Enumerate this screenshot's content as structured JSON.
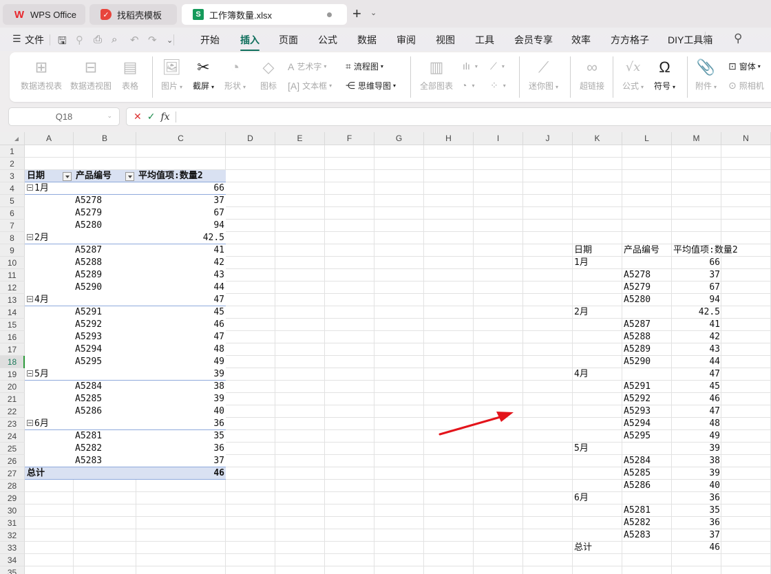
{
  "tabs": [
    {
      "label": "WPS Office",
      "icon": "wps-logo-icon",
      "color": "#e8262c"
    },
    {
      "label": "找稻壳模板",
      "icon": "docer-icon",
      "color": "#e8453c"
    },
    {
      "label": "工作簿数量.xlsx",
      "icon": "spreadsheet-s-icon",
      "color": "#159a5b",
      "active": true
    }
  ],
  "newtab_label": "+",
  "menu": {
    "file_label": "文件",
    "items": [
      "开始",
      "插入",
      "页面",
      "公式",
      "数据",
      "审阅",
      "视图",
      "工具",
      "会员专享",
      "效率",
      "方方格子",
      "DIY工具箱"
    ],
    "active": "插入"
  },
  "ribbon": {
    "pivot_table": "数据透视表",
    "pivot_chart": "数据透视图",
    "table": "表格",
    "picture": "图片",
    "screenshot": "截屏",
    "shape": "形状",
    "icon": "图标",
    "wordart": "艺术字",
    "textbox": "文本框",
    "flowchart": "流程图",
    "mindmap": "思维导图",
    "all_charts": "全部图表",
    "sparkline": "迷你图",
    "hyperlink": "超链接",
    "formula": "公式",
    "symbol": "符号",
    "attachment": "附件",
    "form": "窗体",
    "camera": "照相机"
  },
  "formula_bar": {
    "name_box": "Q18",
    "fx": "fx",
    "value": ""
  },
  "columns": [
    "A",
    "B",
    "C",
    "D",
    "E",
    "F",
    "G",
    "H",
    "I",
    "J",
    "K",
    "L",
    "M",
    "N"
  ],
  "row_count": 35,
  "selected_row": 18,
  "pivot": {
    "headers": [
      "日期",
      "产品编号",
      "平均值项:数量2"
    ],
    "rows": [
      {
        "row": 4,
        "date": "1月",
        "product": "",
        "value": "66",
        "group": true
      },
      {
        "row": 5,
        "date": "",
        "product": "A5278",
        "value": "37"
      },
      {
        "row": 6,
        "date": "",
        "product": "A5279",
        "value": "67"
      },
      {
        "row": 7,
        "date": "",
        "product": "A5280",
        "value": "94"
      },
      {
        "row": 8,
        "date": "2月",
        "product": "",
        "value": "42.5",
        "group": true
      },
      {
        "row": 9,
        "date": "",
        "product": "A5287",
        "value": "41"
      },
      {
        "row": 10,
        "date": "",
        "product": "A5288",
        "value": "42"
      },
      {
        "row": 11,
        "date": "",
        "product": "A5289",
        "value": "43"
      },
      {
        "row": 12,
        "date": "",
        "product": "A5290",
        "value": "44"
      },
      {
        "row": 13,
        "date": "4月",
        "product": "",
        "value": "47",
        "group": true
      },
      {
        "row": 14,
        "date": "",
        "product": "A5291",
        "value": "45"
      },
      {
        "row": 15,
        "date": "",
        "product": "A5292",
        "value": "46"
      },
      {
        "row": 16,
        "date": "",
        "product": "A5293",
        "value": "47"
      },
      {
        "row": 17,
        "date": "",
        "product": "A5294",
        "value": "48"
      },
      {
        "row": 18,
        "date": "",
        "product": "A5295",
        "value": "49"
      },
      {
        "row": 19,
        "date": "5月",
        "product": "",
        "value": "39",
        "group": true
      },
      {
        "row": 20,
        "date": "",
        "product": "A5284",
        "value": "38"
      },
      {
        "row": 21,
        "date": "",
        "product": "A5285",
        "value": "39"
      },
      {
        "row": 22,
        "date": "",
        "product": "A5286",
        "value": "40"
      },
      {
        "row": 23,
        "date": "6月",
        "product": "",
        "value": "36",
        "group": true
      },
      {
        "row": 24,
        "date": "",
        "product": "A5281",
        "value": "35"
      },
      {
        "row": 25,
        "date": "",
        "product": "A5282",
        "value": "36"
      },
      {
        "row": 26,
        "date": "",
        "product": "A5283",
        "value": "37"
      }
    ],
    "total_label": "总计",
    "total_value": "46"
  },
  "copy_table": {
    "header_row": 9,
    "headers": [
      "日期",
      "产品编号",
      "平均值项:数量2"
    ],
    "rows": [
      {
        "date": "1月",
        "product": "",
        "value": "66"
      },
      {
        "date": "",
        "product": "A5278",
        "value": "37"
      },
      {
        "date": "",
        "product": "A5279",
        "value": "67"
      },
      {
        "date": "",
        "product": "A5280",
        "value": "94"
      },
      {
        "date": "2月",
        "product": "",
        "value": "42.5"
      },
      {
        "date": "",
        "product": "A5287",
        "value": "41"
      },
      {
        "date": "",
        "product": "A5288",
        "value": "42"
      },
      {
        "date": "",
        "product": "A5289",
        "value": "43"
      },
      {
        "date": "",
        "product": "A5290",
        "value": "44"
      },
      {
        "date": "4月",
        "product": "",
        "value": "47"
      },
      {
        "date": "",
        "product": "A5291",
        "value": "45"
      },
      {
        "date": "",
        "product": "A5292",
        "value": "46"
      },
      {
        "date": "",
        "product": "A5293",
        "value": "47"
      },
      {
        "date": "",
        "product": "A5294",
        "value": "48"
      },
      {
        "date": "",
        "product": "A5295",
        "value": "49"
      },
      {
        "date": "5月",
        "product": "",
        "value": "39"
      },
      {
        "date": "",
        "product": "A5284",
        "value": "38"
      },
      {
        "date": "",
        "product": "A5285",
        "value": "39"
      },
      {
        "date": "",
        "product": "A5286",
        "value": "40"
      },
      {
        "date": "6月",
        "product": "",
        "value": "36"
      },
      {
        "date": "",
        "product": "A5281",
        "value": "35"
      },
      {
        "date": "",
        "product": "A5282",
        "value": "36"
      },
      {
        "date": "",
        "product": "A5283",
        "value": "37"
      },
      {
        "date": "总计",
        "product": "",
        "value": "46"
      }
    ]
  },
  "annotation": {
    "type": "arrow",
    "color": "#e3141b"
  }
}
